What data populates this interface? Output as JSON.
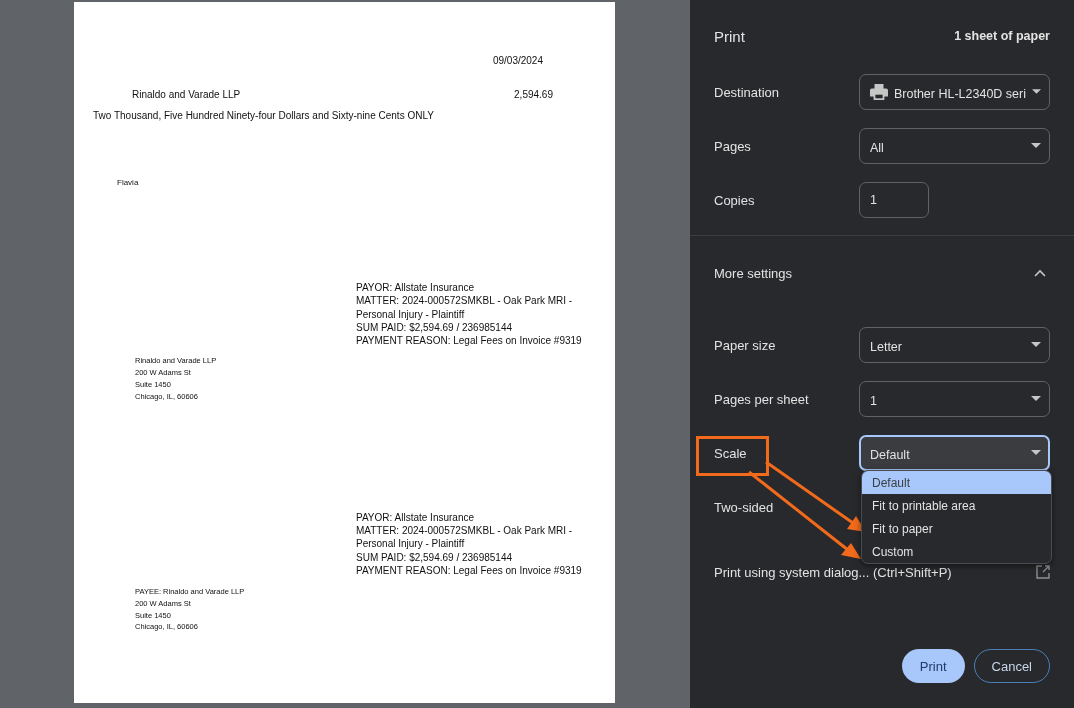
{
  "document": {
    "date": "09/03/2024",
    "payee": "Rinaldo and Varade LLP",
    "amount": "2,594.69",
    "amount_words": "Two Thousand, Five Hundred Ninety-four Dollars and Sixty-nine Cents ONLY",
    "signature": "Flavia",
    "stubs": [
      {
        "lines": [
          "PAYOR: Allstate Insurance",
          "MATTER: 2024-000572SMKBL - Oak Park MRI - Personal Injury - Plaintiff",
          "SUM PAID: $2,594.69 / 236985144",
          "PAYMENT REASON: Legal Fees on Invoice #9319"
        ],
        "address": [
          "Rinaldo and Varade LLP",
          "200 W Adams St",
          "Suite 1450",
          "Chicago, IL, 60606"
        ]
      },
      {
        "lines": [
          "PAYOR: Allstate Insurance",
          "MATTER: 2024-000572SMKBL - Oak Park MRI - Personal Injury - Plaintiff",
          "SUM PAID: $2,594.69 / 236985144",
          "PAYMENT REASON: Legal Fees on Invoice #9319"
        ],
        "address": [
          "PAYEE: Rinaldo and Varade LLP",
          "200 W Adams St",
          "Suite 1450",
          "Chicago, IL, 60606"
        ]
      }
    ]
  },
  "print_panel": {
    "title": "Print",
    "sheet_count": "1 sheet of paper",
    "settings": [
      {
        "label": "Destination",
        "kind": "printer-select",
        "value": "Brother HL-L2340D seri",
        "expanded": false
      },
      {
        "label": "Pages",
        "kind": "select",
        "value": "All",
        "expanded": false
      },
      {
        "label": "Copies",
        "kind": "number",
        "value": "1"
      }
    ],
    "more_settings": {
      "label": "More settings",
      "expanded": true
    },
    "advanced": [
      {
        "label": "Paper size",
        "kind": "select",
        "value": "Letter",
        "expanded": false
      },
      {
        "label": "Pages per sheet",
        "kind": "select",
        "value": "1",
        "expanded": false
      },
      {
        "label": "Scale",
        "kind": "select",
        "value": "Default",
        "expanded": true,
        "options": [
          {
            "label": "Default",
            "selected": true
          },
          {
            "label": "Fit to printable area",
            "selected": false
          },
          {
            "label": "Fit to paper",
            "selected": false
          },
          {
            "label": "Custom",
            "selected": false
          }
        ]
      },
      {
        "label": "Two-sided",
        "kind": "label"
      }
    ],
    "system_dialog": "Print using system dialog... (Ctrl+Shift+P)",
    "buttons": [
      {
        "label": "Print",
        "kind": "primary"
      },
      {
        "label": "Cancel",
        "kind": "secondary"
      }
    ]
  }
}
